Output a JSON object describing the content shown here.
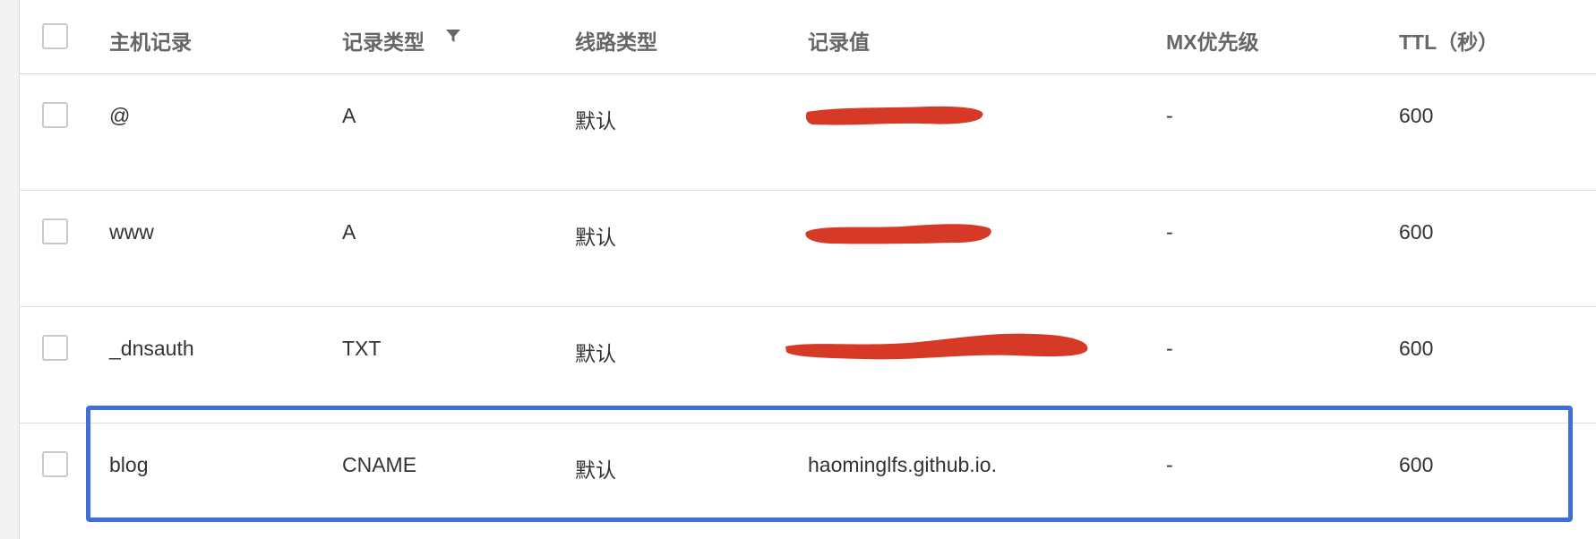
{
  "table": {
    "columns": {
      "checkbox": "",
      "host": "主机记录",
      "type": "记录类型",
      "line": "线路类型",
      "value": "记录值",
      "mx": "MX优先级",
      "ttl": "TTL（秒）"
    },
    "filter_icon": "filter-icon",
    "rows": [
      {
        "host": "@",
        "type": "A",
        "line": "默认",
        "value": "",
        "value_redacted": true,
        "mx": "-",
        "ttl": "600"
      },
      {
        "host": "www",
        "type": "A",
        "line": "默认",
        "value": "",
        "value_redacted": true,
        "mx": "-",
        "ttl": "600"
      },
      {
        "host": "_dnsauth",
        "type": "TXT",
        "line": "默认",
        "value": "",
        "value_redacted": true,
        "mx": "-",
        "ttl": "600"
      },
      {
        "host": "blog",
        "type": "CNAME",
        "line": "默认",
        "value": "haominglfs.github.io.",
        "value_redacted": false,
        "mx": "-",
        "ttl": "600"
      }
    ]
  },
  "colors": {
    "redaction": "#d63a26",
    "highlight_border": "#3e6fd8",
    "header_text": "#666666",
    "body_text": "#333333"
  }
}
